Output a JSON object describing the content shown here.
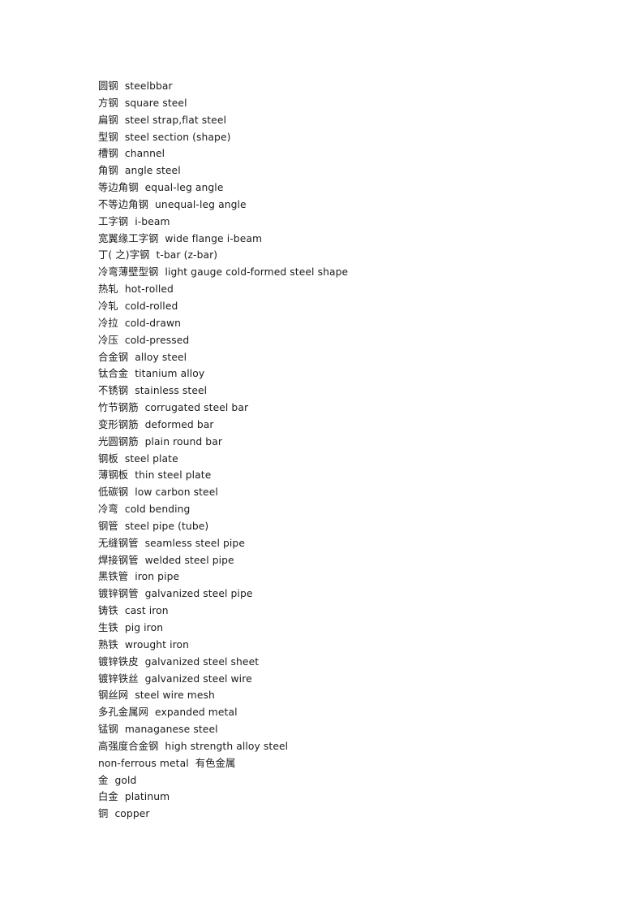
{
  "document": {
    "background_color": "#ffffff",
    "text_color": "#1a1a1a",
    "entries": [
      {
        "term": "圆钢",
        "gloss": "steelbbar"
      },
      {
        "term": "方钢",
        "gloss": "square steel"
      },
      {
        "term": "扁钢",
        "gloss": "steel strap,flat steel"
      },
      {
        "term": "型钢",
        "gloss": "steel section (shape)"
      },
      {
        "term": "槽钢",
        "gloss": "channel"
      },
      {
        "term": "角钢",
        "gloss": "angle steel"
      },
      {
        "term": "等边角钢",
        "gloss": "equal-leg angle"
      },
      {
        "term": "不等边角钢",
        "gloss": "unequal-leg angle"
      },
      {
        "term": "工字钢",
        "gloss": "i-beam"
      },
      {
        "term": "宽翼缘工字钢",
        "gloss": "wide flange i-beam"
      },
      {
        "term": "丁( 之)字钢",
        "gloss": "t-bar (z-bar)"
      },
      {
        "term": "冷弯薄壁型钢",
        "gloss": "light gauge cold-formed steel shape"
      },
      {
        "term": "热轧",
        "gloss": "hot-rolled"
      },
      {
        "term": "冷轧",
        "gloss": "cold-rolled"
      },
      {
        "term": "冷拉",
        "gloss": "cold-drawn"
      },
      {
        "term": "冷压",
        "gloss": "cold-pressed"
      },
      {
        "term": "合金钢",
        "gloss": "alloy steel"
      },
      {
        "term": "钛合金",
        "gloss": "titanium alloy"
      },
      {
        "term": "不锈钢",
        "gloss": "stainless steel"
      },
      {
        "term": "竹节钢筋",
        "gloss": "corrugated steel bar"
      },
      {
        "term": "变形钢筋",
        "gloss": "deformed bar"
      },
      {
        "term": "光圆钢筋",
        "gloss": "plain round bar"
      },
      {
        "term": "钢板",
        "gloss": "steel plate"
      },
      {
        "term": "薄钢板",
        "gloss": "thin steel plate"
      },
      {
        "term": "低碳钢",
        "gloss": "low carbon steel"
      },
      {
        "term": "冷弯",
        "gloss": "cold bending"
      },
      {
        "term": "钢管",
        "gloss": "steel pipe (tube)"
      },
      {
        "term": "无缝钢管",
        "gloss": "seamless steel pipe"
      },
      {
        "term": "焊接钢管",
        "gloss": "welded steel pipe"
      },
      {
        "term": "黑铁管",
        "gloss": "iron pipe"
      },
      {
        "term": "镀锌钢管",
        "gloss": "galvanized steel pipe"
      },
      {
        "term": "铸铁",
        "gloss": "cast iron"
      },
      {
        "term": "生铁",
        "gloss": "pig iron"
      },
      {
        "term": "熟铁",
        "gloss": "wrought iron"
      },
      {
        "term": "镀锌铁皮",
        "gloss": "galvanized steel sheet"
      },
      {
        "term": "镀锌铁丝",
        "gloss": "galvanized steel wire"
      },
      {
        "term": "钢丝网",
        "gloss": "steel wire mesh"
      },
      {
        "term": "多孔金属网",
        "gloss": "expanded metal"
      },
      {
        "term": "锰钢",
        "gloss": "managanese steel"
      },
      {
        "term": "高强度合金钢",
        "gloss": "high strength alloy steel"
      },
      {
        "term": "non-ferrous metal",
        "gloss": "有色金属"
      },
      {
        "term": "金",
        "gloss": "gold"
      },
      {
        "term": "白金",
        "gloss": "platinum"
      },
      {
        "term": "铜",
        "gloss": "copper"
      }
    ]
  }
}
